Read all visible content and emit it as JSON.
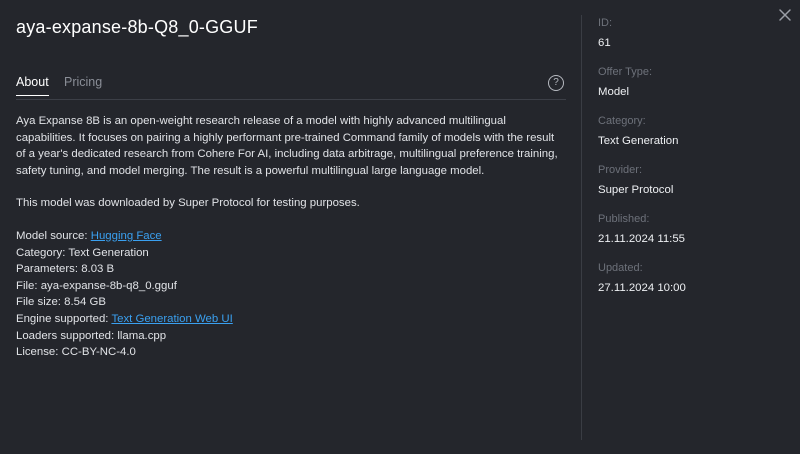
{
  "title": "aya-expanse-8b-Q8_0-GGUF",
  "tabs": [
    {
      "label": "About",
      "active": true
    },
    {
      "label": "Pricing",
      "active": false
    }
  ],
  "help_icon_glyph": "?",
  "about": {
    "description": "Aya Expanse 8B is an open-weight research release of a model with highly advanced multilingual capabilities. It focuses on pairing a highly performant pre-trained Command family of models with the result of a year's dedicated research from Cohere For AI, including data arbitrage, multilingual preference training, safety tuning, and model merging. The result is a powerful multilingual large language model.",
    "note": "This model was downloaded by Super Protocol for testing purposes.",
    "model_source_label": "Model source:",
    "model_source_value": "Hugging Face",
    "category_label": "Category:",
    "category_value": "Text Generation",
    "parameters_label": "Parameters:",
    "parameters_value": "8.03 B",
    "file_label": "File:",
    "file_value": "aya-expanse-8b-q8_0.gguf",
    "file_size_label": "File size:",
    "file_size_value": "8.54 GB",
    "engine_label": "Engine supported:",
    "engine_value": "Text Generation Web UI",
    "loaders_label": "Loaders supported:",
    "loaders_value": "llama.cpp",
    "license_label": "License:",
    "license_value": "CC-BY-NC-4.0"
  },
  "details": [
    {
      "label": "ID:",
      "value": "61"
    },
    {
      "label": "Offer Type:",
      "value": "Model"
    },
    {
      "label": "Category:",
      "value": "Text Generation"
    },
    {
      "label": "Provider:",
      "value": "Super Protocol"
    },
    {
      "label": "Published:",
      "value": "21.11.2024 11:55"
    },
    {
      "label": "Updated:",
      "value": "27.11.2024 10:00"
    }
  ],
  "colors": {
    "background": "#24262c",
    "link": "#3aa0f0",
    "muted_label": "#6d717a"
  }
}
